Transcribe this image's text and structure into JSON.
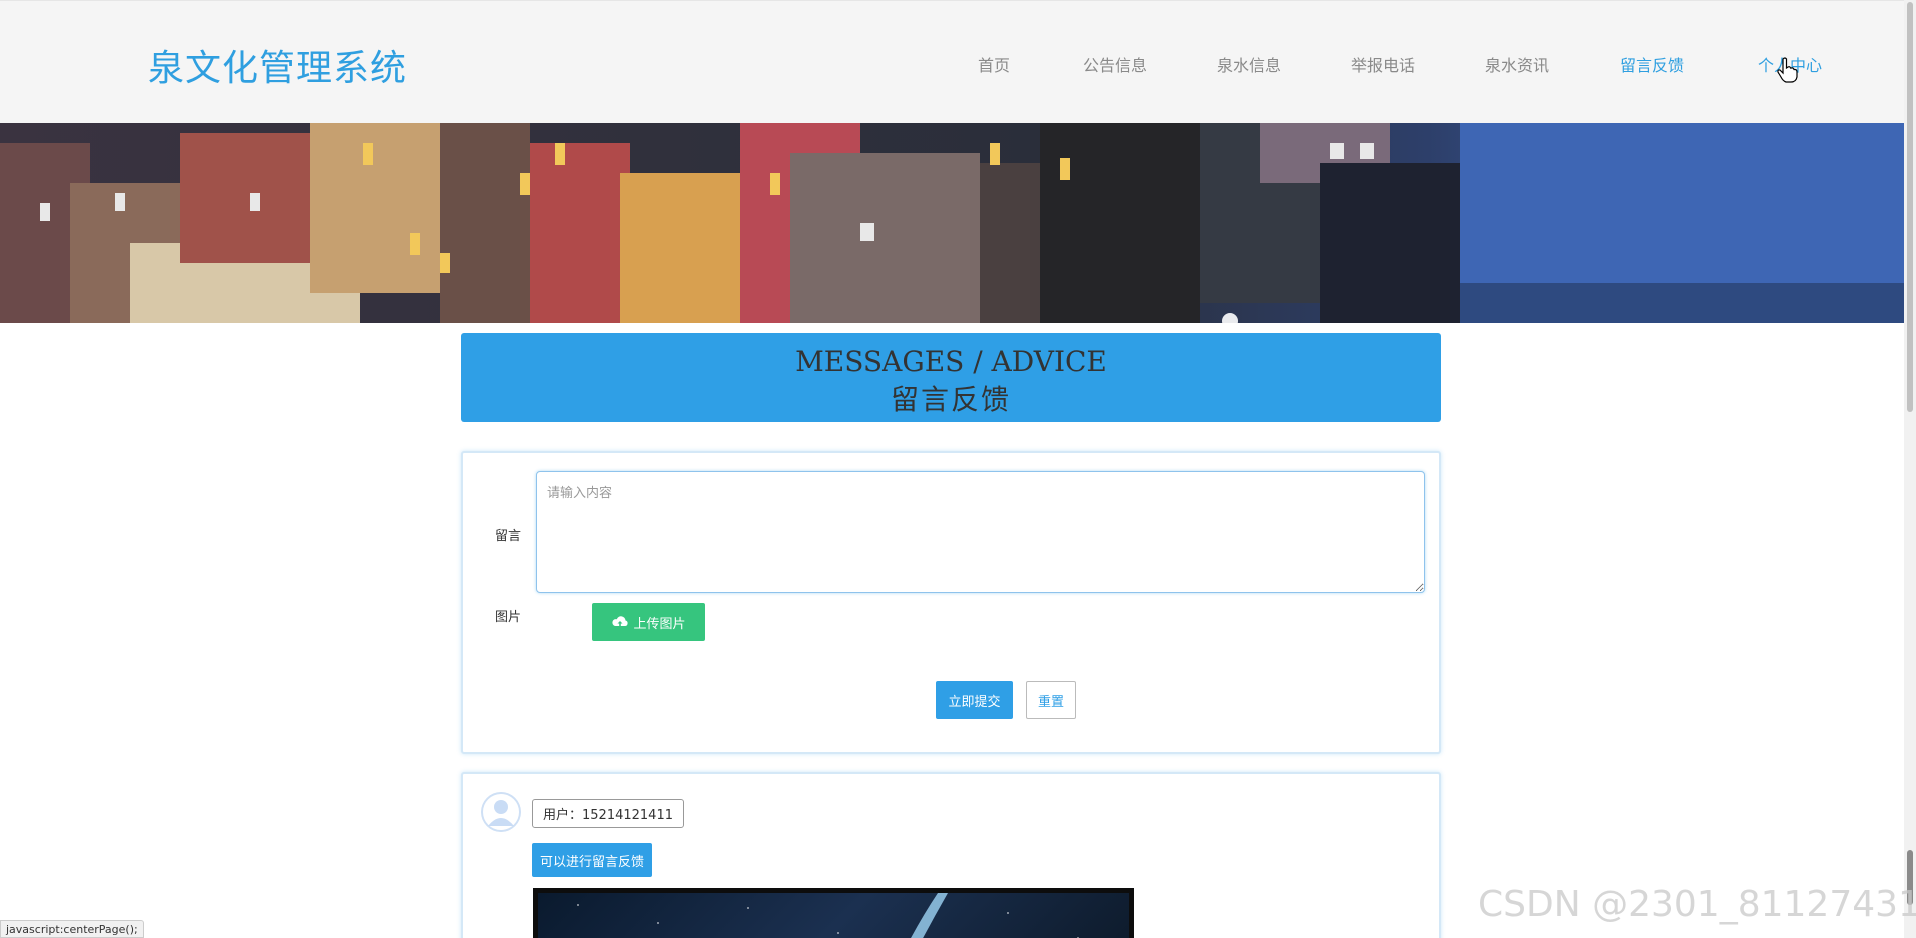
{
  "header": {
    "logo": "泉文化管理系统",
    "nav": [
      {
        "label": "首页",
        "active": false
      },
      {
        "label": "公告信息",
        "active": false
      },
      {
        "label": "泉水信息",
        "active": false
      },
      {
        "label": "举报电话",
        "active": false
      },
      {
        "label": "泉水资讯",
        "active": false
      },
      {
        "label": "留言反馈",
        "active": true
      },
      {
        "label": "个人中心",
        "active": true
      }
    ]
  },
  "page_title": {
    "english": "MESSAGES / ADVICE",
    "chinese": "留言反馈"
  },
  "form": {
    "message_label": "留言",
    "message_placeholder": "请输入内容",
    "message_value": "",
    "image_label": "图片",
    "upload_label": "上传图片",
    "submit_label": "立即提交",
    "reset_label": "重置"
  },
  "messages": [
    {
      "user": "用户：15214121411",
      "content": "可以进行留言反馈"
    }
  ],
  "status_bar": "javascript:centerPage();",
  "watermark": "CSDN @2301_81127431",
  "colors": {
    "primary": "#2f9fe6",
    "upload_green": "#36c57e",
    "header_bg": "#f5f5f5",
    "nav_text": "#8a8a8a"
  },
  "icons": {
    "upload": "cloud-upload-icon",
    "avatar": "user-avatar-icon",
    "cursor": "hand-pointer-icon"
  }
}
